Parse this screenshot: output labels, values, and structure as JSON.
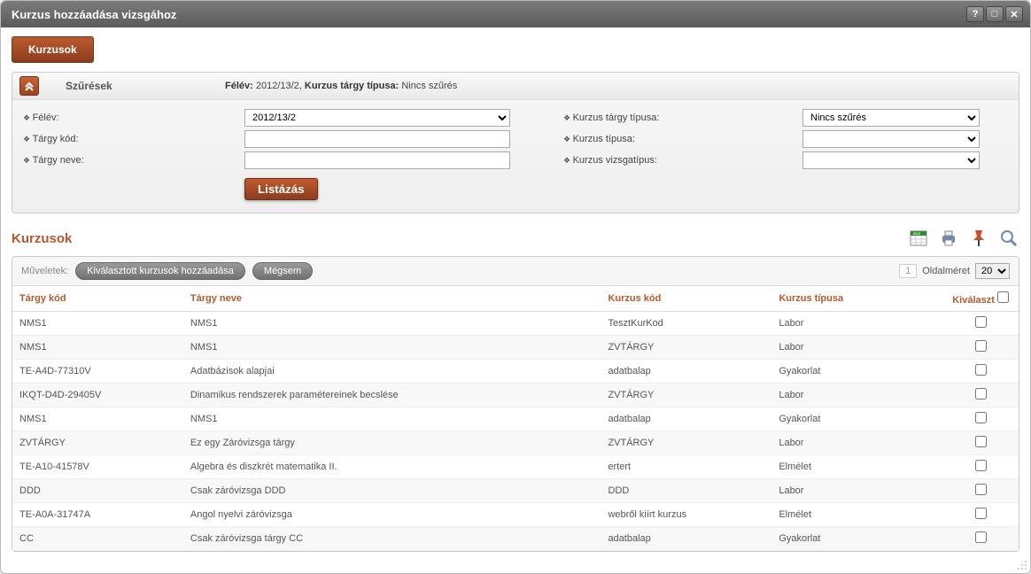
{
  "window": {
    "title": "Kurzus hozzáadása vizsgához"
  },
  "tabs": {
    "active": "Kurzusok"
  },
  "filters": {
    "panel_title": "Szűrések",
    "summary_semester_label": "Félév:",
    "summary_semester_value": "2012/13/2,",
    "summary_type_label": "Kurzus tárgy típusa:",
    "summary_type_value": "Nincs szűrés",
    "labels": {
      "semester": "Félév:",
      "subject_code": "Tárgy kód:",
      "subject_name": "Tárgy neve:",
      "course_subject_type": "Kurzus tárgy típusa:",
      "course_type": "Kurzus típusa:",
      "course_exam_type": "Kurzus vizsgatípus:"
    },
    "values": {
      "semester": "2012/13/2",
      "subject_code": "",
      "subject_name": "",
      "course_subject_type": "Nincs szűrés",
      "course_type": "",
      "course_exam_type": ""
    },
    "list_button": "Listázás"
  },
  "section": {
    "title": "Kurzusok"
  },
  "ops": {
    "label": "Műveletek:",
    "add_selected": "Kiválasztott kurzusok hozzáadása",
    "cancel": "Mégsem",
    "page_number": "1",
    "page_size_label": "Oldalméret",
    "page_size_value": "20"
  },
  "table": {
    "headers": {
      "subject_code": "Tárgy kód",
      "subject_name": "Tárgy neve",
      "course_code": "Kurzus kód",
      "course_type": "Kurzus típusa",
      "select": "Kiválaszt"
    },
    "rows": [
      {
        "subject_code": "NMS1",
        "subject_name": "NMS1",
        "course_code": "TesztKurKod",
        "course_type": "Labor"
      },
      {
        "subject_code": "NMS1",
        "subject_name": "NMS1",
        "course_code": "ZVTÁRGY",
        "course_type": "Labor"
      },
      {
        "subject_code": "TE-A4D-77310V",
        "subject_name": "Adatbázisok alapjai",
        "course_code": "adatbalap",
        "course_type": "Gyakorlat"
      },
      {
        "subject_code": "IKQT-D4D-29405V",
        "subject_name": "Dinamikus rendszerek paramétereinek becslése",
        "course_code": "ZVTÁRGY",
        "course_type": "Labor"
      },
      {
        "subject_code": "NMS1",
        "subject_name": "NMS1",
        "course_code": "adatbalap",
        "course_type": "Gyakorlat"
      },
      {
        "subject_code": "ZVTÁRGY",
        "subject_name": "Ez egy Záróvizsga tárgy",
        "course_code": "ZVTÁRGY",
        "course_type": "Labor"
      },
      {
        "subject_code": "TE-A10-41578V",
        "subject_name": "Algebra és diszkrét matematika II.",
        "course_code": "ertert",
        "course_type": "Elmélet"
      },
      {
        "subject_code": "DDD",
        "subject_name": "Csak záróvizsga DDD",
        "course_code": "DDD",
        "course_type": "Labor"
      },
      {
        "subject_code": "TE-A0A-31747A",
        "subject_name": "Angol nyelvi záróvizsga",
        "course_code": "webről kiírt kurzus",
        "course_type": "Elmélet"
      },
      {
        "subject_code": "CC",
        "subject_name": "Csak záróvizsga tárgy CC",
        "course_code": "adatbalap",
        "course_type": "Gyakorlat"
      }
    ]
  }
}
